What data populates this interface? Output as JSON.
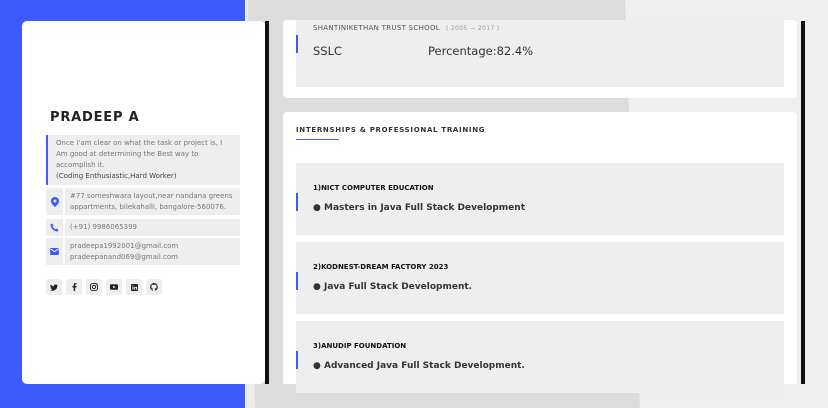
{
  "profile": {
    "name": "PRADEEP A",
    "about": "Once I'am clear on what the task or project is, I Am good at determining the Best way to accomplish it.",
    "about_strong": "(Coding Enthusiastic,Hard Worker)",
    "address": "#77 someshwara layout,near nandana greens appartments, bilekahalli, bangalore-560076.",
    "phone": "(+91) 9986065399",
    "email1": "pradeepa1992001@gmail.com",
    "email2": "pradeepanand069@gmail.com"
  },
  "icons": {
    "location": "map-pin-icon",
    "phone": "phone-icon",
    "email": "envelope-icon",
    "socials": [
      "twitter-icon",
      "facebook-icon",
      "instagram-icon",
      "youtube-icon",
      "linkedin-icon",
      "github-icon"
    ]
  },
  "education": {
    "school": "SHANTINIKETHAN TRUST SCHOOL",
    "years": "( 2005 — 2017 )",
    "level": "SSLC",
    "percentage": "Percentage:82.4%"
  },
  "internships": {
    "title": "INTERNSHIPS & PROFESSIONAL TRAINING",
    "items": [
      {
        "head": "1)NICT COMPUTER EDUCATION",
        "detail": "● Masters in Java Full Stack Development"
      },
      {
        "head": "2)KODNEST-DREAM FACTORY 2023",
        "detail": "● Java Full Stack Development."
      },
      {
        "head": "3)ANUDIP FOUNDATION",
        "detail": "● Advanced Java Full Stack Development."
      }
    ]
  },
  "colors": {
    "accent": "#3d5afe",
    "panel": "#eeeeee"
  }
}
